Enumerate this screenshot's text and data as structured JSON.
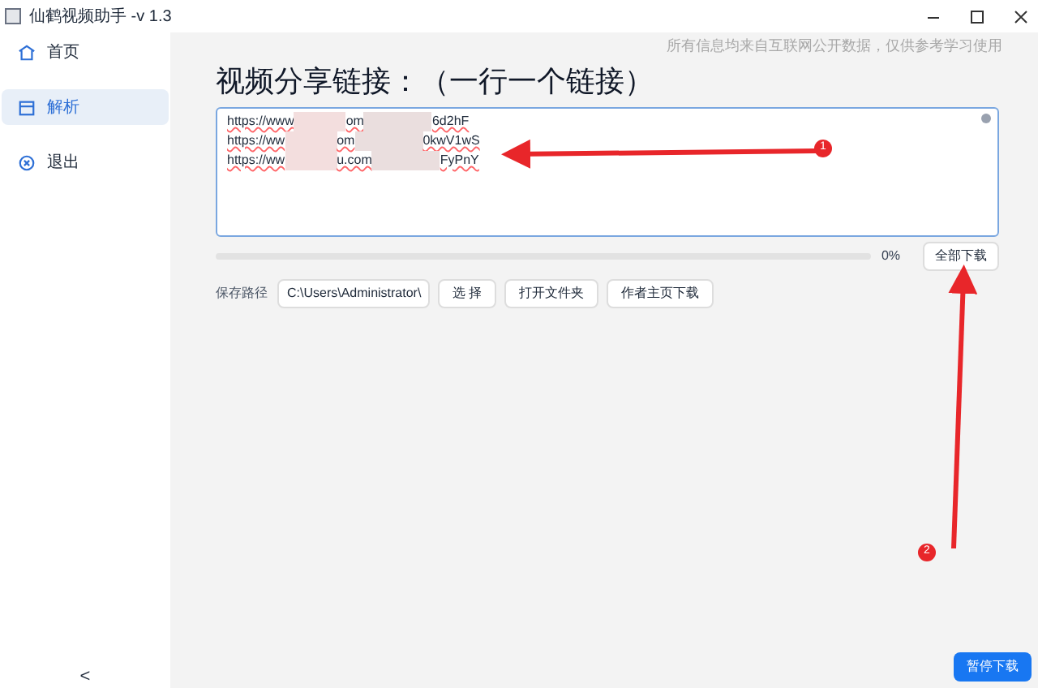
{
  "window": {
    "title": "仙鹤视频助手 -v 1.3"
  },
  "sidebar": {
    "items": [
      {
        "label": "首页",
        "kind": "home",
        "selected": false
      },
      {
        "label": "解析",
        "kind": "parse",
        "selected": true
      },
      {
        "label": "退出",
        "kind": "exit",
        "selected": false
      }
    ],
    "collapse": "<"
  },
  "notice": "所有信息均来自互联网公开数据，仅供参考学习使用",
  "heading": "视频分享链接：（一行一个链接）",
  "links": [
    {
      "start": "https://www",
      "middle": "om",
      "end": "6d2hF"
    },
    {
      "start": "https://ww",
      "middle": "om",
      "end": "0kwV1wS"
    },
    {
      "start": "https://ww",
      "middle": "u.com",
      "end": "FyPnY"
    }
  ],
  "progress": {
    "level": 0,
    "reading": "0%"
  },
  "download_all": "全部下载",
  "save_path": {
    "label": "保存路径",
    "value": "C:\\Users\\Administrator\\"
  },
  "buttons": [
    "选 择",
    "打开文件夹",
    "作者主页下载"
  ],
  "pause": "暂停下载",
  "annotations": [
    "1",
    "2"
  ]
}
